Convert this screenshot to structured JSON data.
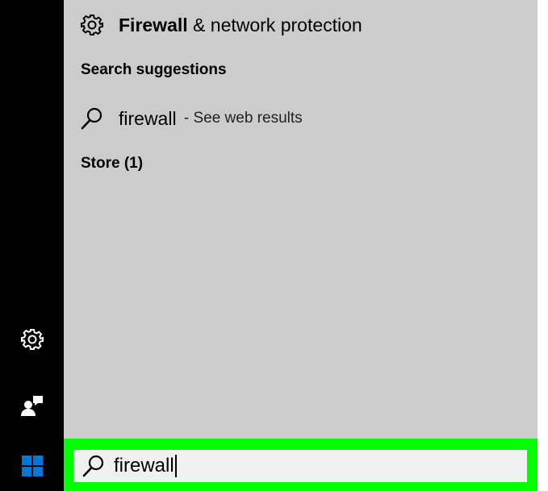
{
  "results": {
    "best_match": {
      "title_bold": "Firewall",
      "title_rest": " & network protection",
      "icon": "gear-icon"
    },
    "search_suggestions_heading": "Search suggestions",
    "suggestion": {
      "query": "firewall",
      "sub": " - See web results",
      "icon": "search-icon"
    },
    "store_heading": "Store (1)"
  },
  "rail": {
    "icons": [
      "gear-icon",
      "user-feedback-icon",
      "windows-logo-icon"
    ]
  },
  "search": {
    "value": "firewall",
    "icon": "search-icon"
  },
  "colors": {
    "panel": "#cccccc",
    "rail": "#000000",
    "highlight": "#00ff00",
    "windows_blue": "#0078d7"
  }
}
